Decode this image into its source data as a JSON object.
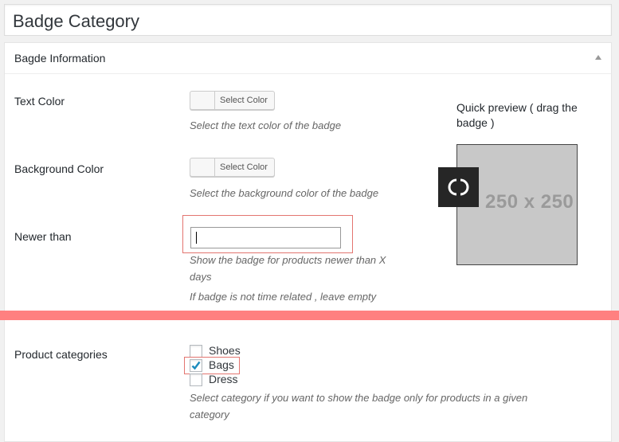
{
  "page": {
    "title": "Badge Category"
  },
  "metabox": {
    "title": "Bagde Information"
  },
  "fields": {
    "text_color": {
      "label": "Text Color",
      "button": "Select Color",
      "desc": "Select the text color of the badge"
    },
    "background_color": {
      "label": "Background Color",
      "button": "Select Color",
      "desc": "Select the background color of the badge"
    },
    "newer_than": {
      "label": "Newer than",
      "value": "",
      "desc1_line1": "Show the badge for products newer than X",
      "desc1_line2": "days",
      "desc2": "If badge is not time related , leave empty"
    },
    "product_categories": {
      "label": "Product categories",
      "options": [
        {
          "label": "Shoes",
          "checked": false
        },
        {
          "label": "Bags",
          "checked": true
        },
        {
          "label": "Dress",
          "checked": false
        }
      ],
      "desc_line1": "Select category if you want to show the badge only for products in a given",
      "desc_line2": "category"
    }
  },
  "preview": {
    "label": "Quick preview ( drag the badge )",
    "dimensions": "250 x 250"
  },
  "colors": {
    "highlight": "#e37570",
    "separator": "#ff8080",
    "badge_bg": "#262626",
    "preview_bg": "#c8c8c8"
  },
  "icons": {
    "badge": "chanel-logo-icon",
    "toggle": "triangle-up-icon",
    "check": "check-icon"
  }
}
